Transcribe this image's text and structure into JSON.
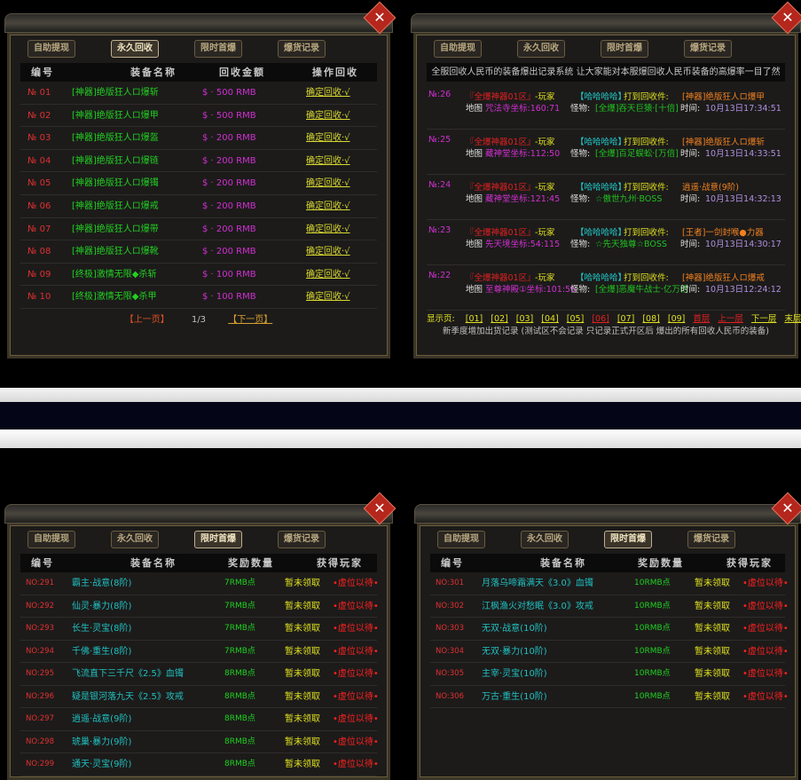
{
  "tabs": [
    "自助提现",
    "永久回收",
    "限时首爆",
    "爆货记录"
  ],
  "close_icon": "✕",
  "recycle": {
    "headers": [
      "编号",
      "装备名称",
      "回收金额",
      "操作回收"
    ],
    "rows": [
      [
        "№ 01",
        "[神器]绝版狂人ロ爆斩",
        "$ · 500 RMB",
        "确定回收·√"
      ],
      [
        "№ 02",
        "[神器]绝版狂人ロ爆甲",
        "$ · 500 RMB",
        "确定回收·√"
      ],
      [
        "№ 03",
        "[神器]绝版狂人ロ爆盔",
        "$ · 200 RMB",
        "确定回收·√"
      ],
      [
        "№ 04",
        "[神器]绝版狂人ロ爆链",
        "$ · 200 RMB",
        "确定回收·√"
      ],
      [
        "№ 05",
        "[神器]绝版狂人ロ爆镯",
        "$ · 200 RMB",
        "确定回收·√"
      ],
      [
        "№ 06",
        "[神器]绝版狂人ロ爆戒",
        "$ · 200 RMB",
        "确定回收·√"
      ],
      [
        "№ 07",
        "[神器]绝版狂人ロ爆带",
        "$ · 200 RMB",
        "确定回收·√"
      ],
      [
        "№ 08",
        "[神器]绝版狂人ロ爆靴",
        "$ · 200 RMB",
        "确定回收·√"
      ],
      [
        "№ 09",
        "[终极]激情无限◆杀斩",
        "$ · 100 RMB",
        "确定回收·√"
      ],
      [
        "№ 10",
        "[终极]激情无限◆杀甲",
        "$ · 100 RMB",
        "确定回收·√"
      ]
    ],
    "prev": "【上一页】",
    "page": "1/3",
    "next": "【下一页】"
  },
  "records": {
    "banner": "全服回收人民币的装备爆出记录系统 让大家能对本服爆回收人民币装备的高爆率一目了然",
    "server": "『全爆神器01区』",
    "player": "-玩家",
    "hero": "【哈哈哈哈】",
    "hit": "打到回收件:",
    "map_label": "地图",
    "monster_label": "怪物:",
    "time_label": "时间:",
    "entries": [
      {
        "no": "№:26",
        "map": "咒法寺坐标:160:71",
        "monster": "[全爆]吞天巨猿·[十倍]",
        "item": "[神器]绝版狂人ロ爆甲",
        "time": "10月13日17:34:51"
      },
      {
        "no": "№:25",
        "map": "藏神堂坐标:112:50",
        "monster": "[全爆]百足蜈蚣·[万倍]",
        "item": "[神器]绝版狂人ロ爆斩",
        "time": "10月13日14:33:51"
      },
      {
        "no": "№:24",
        "map": "藏神堂坐标:121:45",
        "monster": "☆傲世九州·BOSS",
        "item": "逍遥·战意(9阶)",
        "time": "10月13日14:32:13"
      },
      {
        "no": "№:23",
        "map": "先天境坐标:54:115",
        "monster": "☆先天独尊☆BOSS",
        "item": "[王者]一剑封喉●力器",
        "time": "10月13日14:30:17"
      },
      {
        "no": "№:22",
        "map": "至尊神殿①坐标:101:56",
        "monster": "[全爆]恶魔牛战士·亿万倍",
        "item": "[神器]绝版狂人ロ爆戒",
        "time": "10月13日12:24:12"
      }
    ],
    "pages_label": "显示页:",
    "pages": [
      "[01]",
      "[02]",
      "[03]",
      "[04]",
      "[05]",
      "[06]",
      "[07]",
      "[08]",
      "[09]"
    ],
    "first": "首层",
    "prev": "上一层",
    "next": "下一层",
    "last": "末层",
    "note": "新季度增加出货记录 (测试区不会记录 只记录正式开区后 爆出的所有回收人民币的装备)"
  },
  "firstdrop": {
    "headers": [
      "编号",
      "装备名称",
      "奖励数量",
      "获得玩家"
    ],
    "left_rows": [
      [
        "NO:291",
        "霸主·战意(8阶)",
        "7RMB点",
        "暂未领取",
        "•虚位以待•"
      ],
      [
        "NO:292",
        "仙灵·暴力(8阶)",
        "7RMB点",
        "暂未领取",
        "•虚位以待•"
      ],
      [
        "NO:293",
        "长生·灵宝(8阶)",
        "7RMB点",
        "暂未领取",
        "•虚位以待•"
      ],
      [
        "NO:294",
        "千佛·重生(8阶)",
        "7RMB点",
        "暂未领取",
        "•虚位以待•"
      ],
      [
        "NO:295",
        "飞流直下三千尺《2.5》血镯",
        "8RMB点",
        "暂未领取",
        "•虚位以待•"
      ],
      [
        "NO:296",
        "疑是银河落九天《2.5》攻戒",
        "8RMB点",
        "暂未领取",
        "•虚位以待•"
      ],
      [
        "NO:297",
        "逍遥·战意(9阶)",
        "8RMB点",
        "暂未领取",
        "•虚位以待•"
      ],
      [
        "NO:298",
        "琥巢·暴力(9阶)",
        "8RMB点",
        "暂未领取",
        "•虚位以待•"
      ],
      [
        "NO:299",
        "通天·灵宝(9阶)",
        "8RMB点",
        "暂未领取",
        "•虚位以待•"
      ]
    ],
    "right_rows": [
      [
        "NO:301",
        "月落乌啼霜满天《3.0》血镯",
        "10RMB点",
        "暂未领取",
        "•虚位以待•"
      ],
      [
        "NO:302",
        "江枫渔火对愁眠《3.0》攻戒",
        "10RMB点",
        "暂未领取",
        "•虚位以待•"
      ],
      [
        "NO:303",
        "无双·战意(10阶)",
        "10RMB点",
        "暂未领取",
        "•虚位以待•"
      ],
      [
        "NO:304",
        "无双·暴力(10阶)",
        "10RMB点",
        "暂未领取",
        "•虚位以待•"
      ],
      [
        "NO:305",
        "主宰·灵宝(10阶)",
        "10RMB点",
        "暂未领取",
        "•虚位以待•"
      ],
      [
        "NO:306",
        "万古·重生(10阶)",
        "10RMB点",
        "暂未领取",
        "•虚位以待•"
      ]
    ]
  },
  "colors": {
    "no": "#e03030",
    "name_green": "#22d022",
    "money": "#d030d0",
    "link": "#d8d830",
    "name_cyan": "#20c0c0",
    "reward": "#20d020",
    "unclaimed": "#e0e020",
    "waiting": "#ff2020",
    "item_orange": "#f08020",
    "time": "#b090e0"
  }
}
